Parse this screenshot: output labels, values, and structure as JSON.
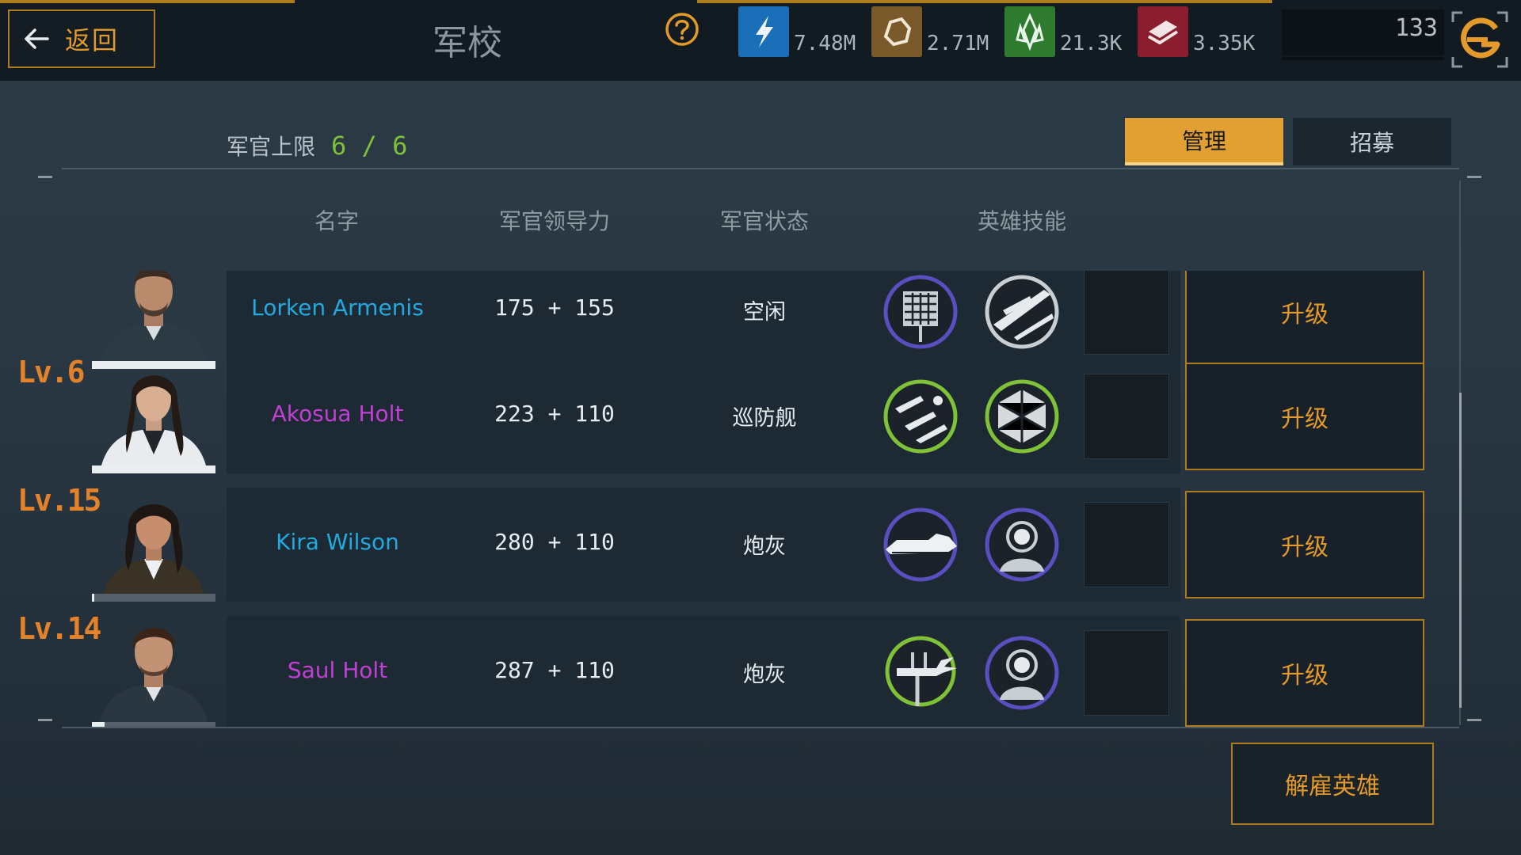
{
  "topbar": {
    "back_label": "返回",
    "title": "军校",
    "resources": [
      {
        "icon": "energy-icon",
        "value": "7.48M",
        "color": "#1a6fb8"
      },
      {
        "icon": "ore-icon",
        "value": "2.71M",
        "color": "#7a5a2a"
      },
      {
        "icon": "crystal-icon",
        "value": "21.3K",
        "color": "#2e7a2e"
      },
      {
        "icon": "alloy-icon",
        "value": "3.35K",
        "color": "#8a1e2e"
      }
    ],
    "counter_value": "133"
  },
  "officer_limit": {
    "label": "军官上限",
    "value": "6 / 6"
  },
  "tabs": {
    "manage": "管理",
    "recruit": "招募"
  },
  "columns": {
    "name": "名字",
    "leadership": "军官领导力",
    "status": "军官状态",
    "skills": "英雄技能"
  },
  "officers": [
    {
      "level": "",
      "name": "Lorken Armenis",
      "name_color": "#21a9e2",
      "power": "175 + 155",
      "status": "空闲",
      "skills": [
        "circuit-skill-icon",
        "fighter-squadron-skill-icon"
      ],
      "hp": 1.0,
      "upgrade": "升级"
    },
    {
      "level": "Lv.6",
      "name": "Akosua Holt",
      "name_color": "#c23fd6",
      "power": "223 + 110",
      "status": "巡防舰",
      "skills": [
        "missile-strike-skill-icon",
        "hex-shield-skill-icon"
      ],
      "hp": 1.0,
      "upgrade": "升级"
    },
    {
      "level": "Lv.15",
      "name": "Kira Wilson",
      "name_color": "#21a9e2",
      "power": "280 + 110",
      "status": "炮灰",
      "skills": [
        "battleship-skill-icon",
        "commander-skill-icon"
      ],
      "hp": 0.02,
      "upgrade": "升级"
    },
    {
      "level": "Lv.14",
      "name": "Saul Holt",
      "name_color": "#c23fd6",
      "power": "287 + 110",
      "status": "炮灰",
      "skills": [
        "turret-blast-skill-icon",
        "commander-skill-icon"
      ],
      "hp": 0.1,
      "upgrade": "升级"
    }
  ],
  "dismiss_label": "解雇英雄"
}
